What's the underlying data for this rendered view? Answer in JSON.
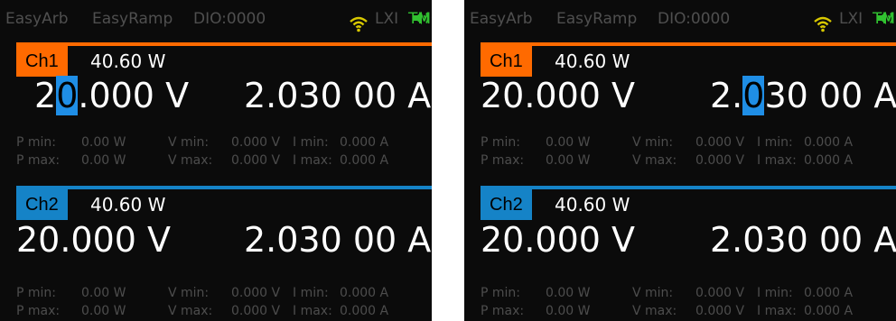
{
  "colors": {
    "ch1": "#ff6a00",
    "ch2": "#1583c7",
    "tmc": "#31c230",
    "cursor": "#1f8ee6"
  },
  "status": {
    "easyarb": "EasyArb",
    "easyramp": "EasyRamp",
    "dio": "DIO:0000",
    "wifi_icon": "wifi-icon",
    "lxi": "LXI",
    "tmc": "TMC",
    "speaker_icon": "speaker-icon"
  },
  "panels": [
    {
      "ch1": {
        "label": "Ch1",
        "power": "40.60 W",
        "voltage": {
          "before": "2",
          "cursor": "0",
          "after": ".000 V"
        },
        "current": {
          "before": "",
          "cursor": "",
          "after": "2.030 00 A"
        },
        "pmin_label": "P min:",
        "pmin": "0.00 W",
        "vmin_label": "V min:",
        "vmin": "0.000 V",
        "imin_label": "I min:",
        "imin": "0.000 A",
        "pmax_label": "P max:",
        "pmax": "0.00 W",
        "vmax_label": "V max:",
        "vmax": "0.000 V",
        "imax_label": "I max:",
        "imax": "0.000 A"
      },
      "ch2": {
        "label": "Ch2",
        "power": "40.60 W",
        "voltage": {
          "before": "",
          "cursor": "",
          "after": "20.000 V"
        },
        "current": {
          "before": "",
          "cursor": "",
          "after": "2.030 00 A"
        },
        "pmin_label": "P min:",
        "pmin": "0.00 W",
        "vmin_label": "V min:",
        "vmin": "0.000 V",
        "imin_label": "I min:",
        "imin": "0.000 A",
        "pmax_label": "P max:",
        "pmax": "0.00 W",
        "vmax_label": "V max:",
        "vmax": "0.000 V",
        "imax_label": "I max:",
        "imax": "0.000 A"
      }
    },
    {
      "ch1": {
        "label": "Ch1",
        "power": "40.60 W",
        "voltage": {
          "before": "",
          "cursor": "",
          "after": "20.000 V"
        },
        "current": {
          "before": "2.",
          "cursor": "0",
          "after": "30 00 A"
        },
        "pmin_label": "P min:",
        "pmin": "0.00 W",
        "vmin_label": "V min:",
        "vmin": "0.000 V",
        "imin_label": "I min:",
        "imin": "0.000 A",
        "pmax_label": "P max:",
        "pmax": "0.00 W",
        "vmax_label": "V max:",
        "vmax": "0.000 V",
        "imax_label": "I max:",
        "imax": "0.000 A"
      },
      "ch2": {
        "label": "Ch2",
        "power": "40.60 W",
        "voltage": {
          "before": "",
          "cursor": "",
          "after": "20.000 V"
        },
        "current": {
          "before": "",
          "cursor": "",
          "after": "2.030 00 A"
        },
        "pmin_label": "P min:",
        "pmin": "0.00 W",
        "vmin_label": "V min:",
        "vmin": "0.000 V",
        "imin_label": "I min:",
        "imin": "0.000 A",
        "pmax_label": "P max:",
        "pmax": "0.00 W",
        "vmax_label": "V max:",
        "vmax": "0.000 V",
        "imax_label": "I max:",
        "imax": "0.000 A"
      }
    }
  ]
}
